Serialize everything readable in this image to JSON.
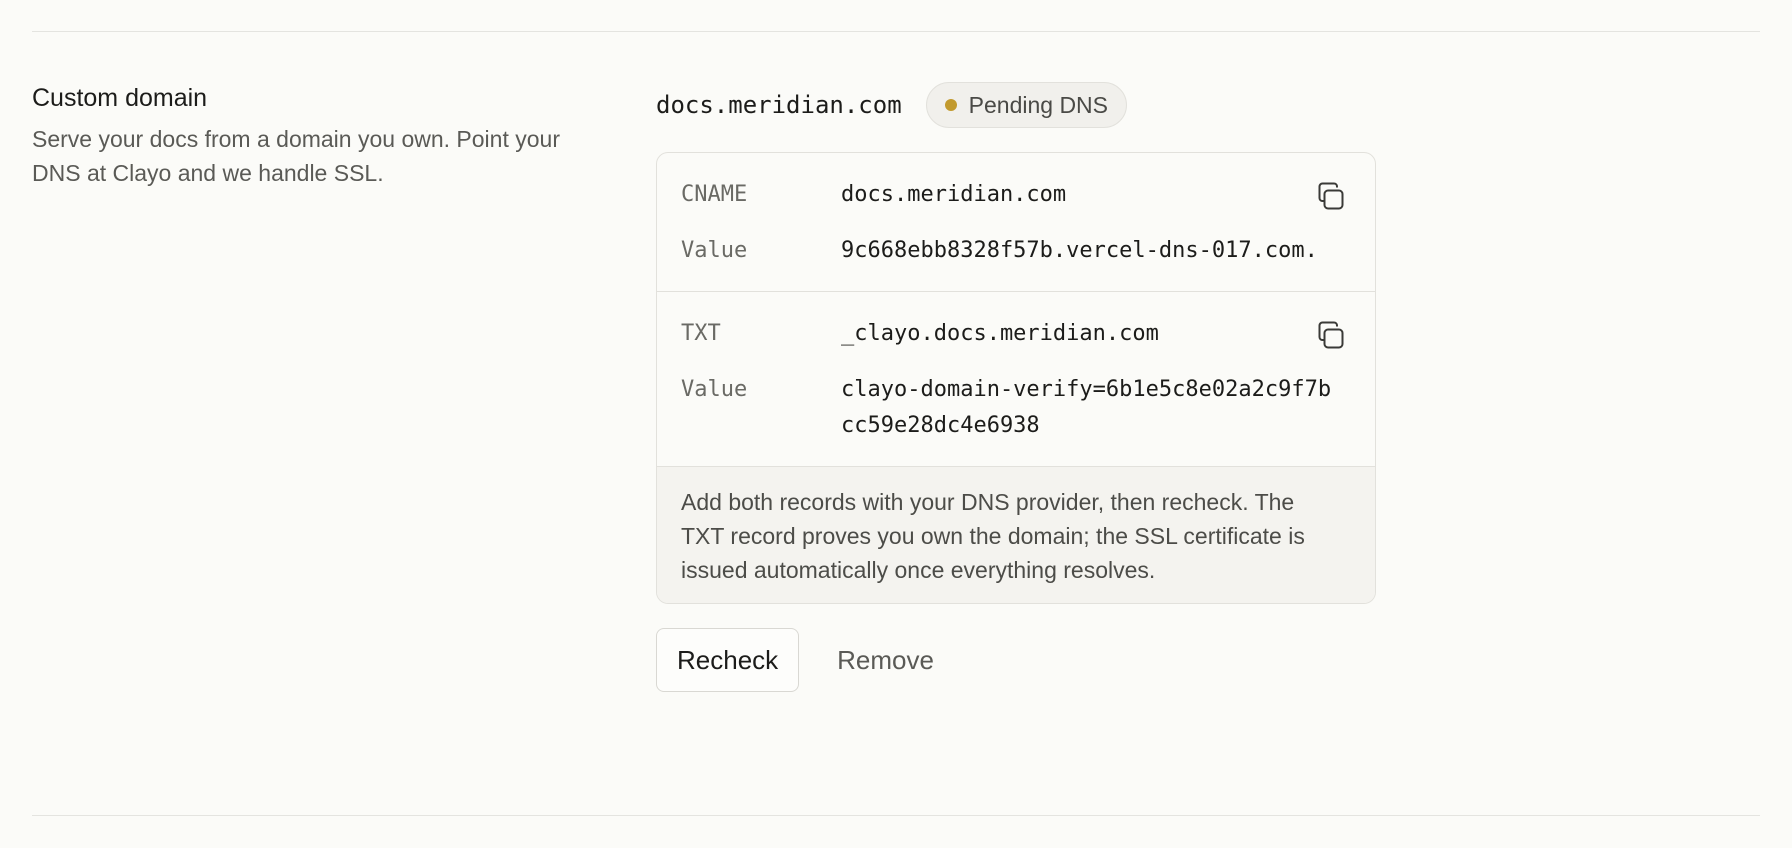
{
  "section": {
    "title": "Custom domain",
    "description": "Serve your docs from a domain you own. Point your DNS at Clayo and we handle SSL."
  },
  "domain": {
    "name": "docs.meridian.com",
    "status": "Pending DNS",
    "status_color": "#c29a2e"
  },
  "records": [
    {
      "type": "CNAME",
      "name": "docs.meridian.com",
      "value_label": "Value",
      "value": "9c668ebb8328f57b.vercel-dns-017.com.",
      "copy_icon": "copy-icon"
    },
    {
      "type": "TXT",
      "name": "_clayo.docs.meridian.com",
      "value_label": "Value",
      "value": "clayo-domain-verify=6b1e5c8e02a2c9f7bcc59e28dc4e6938",
      "copy_icon": "copy-icon"
    }
  ],
  "note": "Add both records with your DNS provider, then recheck. The TXT record proves you own the domain; the SSL certificate is issued automatically once everything resolves.",
  "actions": {
    "recheck_label": "Recheck",
    "remove_label": "Remove"
  }
}
